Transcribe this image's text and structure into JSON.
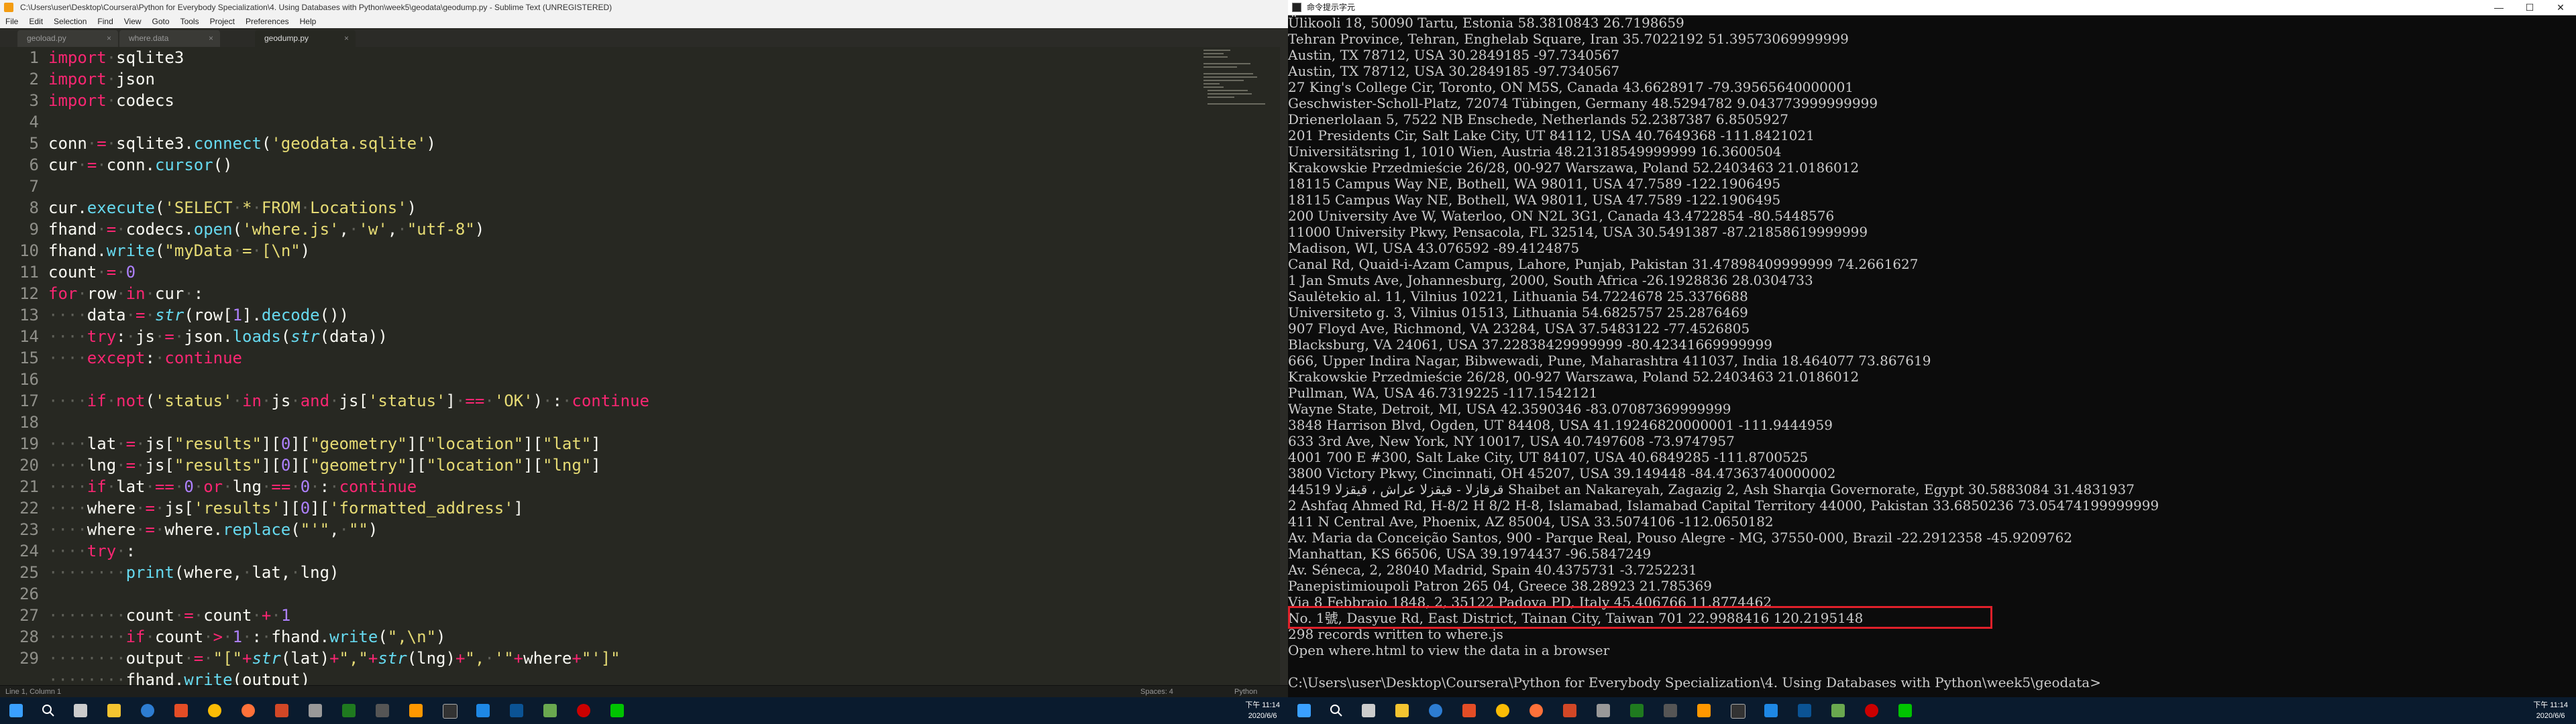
{
  "sublime": {
    "title": "C:\\Users\\user\\Desktop\\Coursera\\Python for Everybody Specialization\\4. Using Databases with Python\\week5\\geodata\\geodump.py - Sublime Text (UNREGISTERED)",
    "menu": [
      "File",
      "Edit",
      "Selection",
      "Find",
      "View",
      "Goto",
      "Tools",
      "Project",
      "Preferences",
      "Help"
    ],
    "tabs": [
      {
        "label": "geoload.py",
        "active": false
      },
      {
        "label": "where.data",
        "active": false
      },
      {
        "label": "geodump.py",
        "active": true
      }
    ],
    "line_numbers": [
      "1",
      "2",
      "3",
      "4",
      "5",
      "6",
      "7",
      "8",
      "9",
      "10",
      "11",
      "12",
      "13",
      "14",
      "15",
      "16",
      "17",
      "18",
      "19",
      "20",
      "21",
      "22",
      "23",
      "24",
      "25",
      "26",
      "27",
      "28",
      "29"
    ],
    "status_left": "Line 1, Column 1",
    "status_spaces": "Spaces: 4",
    "status_syntax": "Python"
  },
  "cmd": {
    "title": "命令提示字元",
    "lines": [
      "Ülikooli 18, 50090 Tartu, Estonia 58.3810843 26.7198659",
      "Tehran Province, Tehran, Enghelab Square, Iran 35.7022192 51.39573069999999",
      "Austin, TX 78712, USA 30.2849185 -97.7340567",
      "Austin, TX 78712, USA 30.2849185 -97.7340567",
      "27 King's College Cir, Toronto, ON M5S, Canada 43.6628917 -79.39565640000001",
      "Geschwister-Scholl-Platz, 72074 Tübingen, Germany 48.5294782 9.043773999999999",
      "Drienerlolaan 5, 7522 NB Enschede, Netherlands 52.2387387 6.8505927",
      "201 Presidents Cir, Salt Lake City, UT 84112, USA 40.7649368 -111.8421021",
      "Universitätsring 1, 1010 Wien, Austria 48.21318549999999 16.3600504",
      "Krakowskie Przedmieście 26/28, 00-927 Warszawa, Poland 52.2403463 21.0186012",
      "18115 Campus Way NE, Bothell, WA 98011, USA 47.7589 -122.1906495",
      "18115 Campus Way NE, Bothell, WA 98011, USA 47.7589 -122.1906495",
      "200 University Ave W, Waterloo, ON N2L 3G1, Canada 43.4722854 -80.5448576",
      "11000 University Pkwy, Pensacola, FL 32514, USA 30.5491387 -87.21858619999999",
      "Madison, WI, USA 43.076592 -89.4124875",
      "Canal Rd, Quaid-i-Azam Campus, Lahore, Punjab, Pakistan 31.47898409999999 74.2661627",
      "1 Jan Smuts Ave, Johannesburg, 2000, South Africa -26.1928836 28.0304733",
      "Saulėtekio al. 11, Vilnius 10221, Lithuania 54.7224678 25.3376688",
      "Universiteto g. 3, Vilnius 01513, Lithuania 54.6825757 25.2876469",
      "907 Floyd Ave, Richmond, VA 23284, USA 37.5483122 -77.4526805",
      "Blacksburg, VA 24061, USA 37.22838429999999 -80.42341669999999",
      "666, Upper Indira Nagar, Bibwewadi, Pune, Maharashtra 411037, India 18.464077 73.867619",
      "Krakowskie Przedmieście 26/28, 00-927 Warszawa, Poland 52.2403463 21.0186012",
      "Pullman, WA, USA 46.7319225 -117.1542121",
      "Wayne State, Detroit, MI, USA 42.3590346 -83.07087369999999",
      "3848 Harrison Blvd, Ogden, UT 84408, USA 41.19246820000001 -111.9444959",
      "633 3rd Ave, New York, NY 10017, USA 40.7497608 -73.9747957",
      "4001 700 E #300, Salt Lake City, UT 84107, USA 40.6849285 -111.8700525",
      "3800 Victory Pkwy, Cincinnati, OH 45207, USA 39.149448 -84.47363740000002",
      "44519 قرقازلا - قيقزلا عراش ، قيقزلا Shaibet an Nakareyah, Zagazig 2, Ash Sharqia Governorate, Egypt 30.5883084 31.4831937",
      "2 Ashfaq Ahmed Rd, H-8/2 H 8/2 H-8, Islamabad, Islamabad Capital Territory 44000, Pakistan 33.6850236 73.05474199999999",
      "411 N Central Ave, Phoenix, AZ 85004, USA 33.5074106 -112.0650182",
      "Av. Maria da Conceição Santos, 900 - Parque Real, Pouso Alegre - MG, 37550-000, Brazil -22.2912358 -45.9209762",
      "Manhattan, KS 66506, USA 39.1974437 -96.5847249",
      "Av. Séneca, 2, 28040 Madrid, Spain 40.4375731 -3.7252231",
      "Panepistimioupoli Patron 265 04, Greece 38.28923 21.785369",
      "Via 8 Febbraio 1848, 2, 35122 Padova PD, Italy 45.406766 11.8774462",
      "No. 1號, Dasyue Rd, East District, Tainan City, Taiwan 701 22.9988416 120.2195148",
      "298 records written to where.js",
      "Open where.html to view the data in a browser",
      "",
      "C:\\Users\\user\\Desktop\\Coursera\\Python for Everybody Specialization\\4. Using Databases with Python\\week5\\geodata>"
    ]
  },
  "taskbar_left": {
    "time": "下午 11:14",
    "date": "2020/6/6"
  },
  "taskbar_right": {
    "time": "下午 11:14",
    "date": "2020/6/6"
  },
  "colors": {
    "highlight": "#e0202a",
    "editor_bg": "#272822",
    "console_bg": "#0c0c0c"
  }
}
